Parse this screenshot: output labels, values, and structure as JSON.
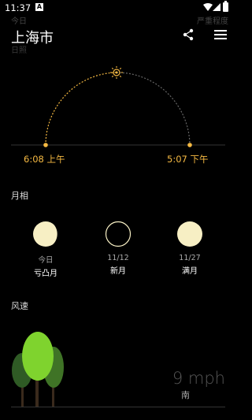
{
  "status_bar": {
    "time": "11:37",
    "a_icon": "A"
  },
  "faded_top": {
    "left": "今日",
    "right": "严重程度"
  },
  "header": {
    "city": "上海市",
    "sub": "日照"
  },
  "sun": {
    "sunrise": "6:08 上午",
    "sunset": "5:07 下午"
  },
  "sections": {
    "moon": "月相",
    "wind": "风速"
  },
  "moon_phases": [
    {
      "date": "今日",
      "phase": "亏凸月"
    },
    {
      "date": "11/12",
      "phase": "新月"
    },
    {
      "date": "11/27",
      "phase": "满月"
    }
  ],
  "wind": {
    "speed": "9 mph",
    "direction": "南"
  }
}
